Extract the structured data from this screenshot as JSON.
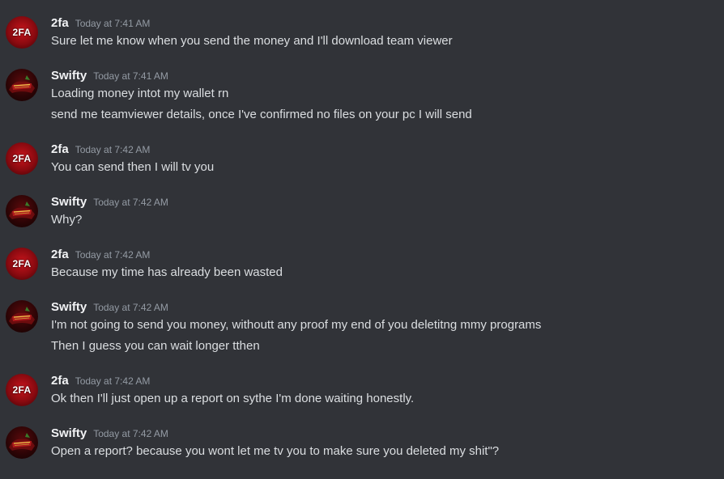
{
  "messages": [
    {
      "author": "2fa",
      "avatar_text": "2FA",
      "timestamp": "Today at 7:41 AM",
      "lines": [
        "Sure let me know when you send the money and I'll download team viewer"
      ]
    },
    {
      "author": "Swifty",
      "avatar_text": "",
      "timestamp": "Today at 7:41 AM",
      "lines": [
        "Loading money intot my wallet rn",
        "send me teamviewer details, once I've confirmed no files on your pc I will send"
      ]
    },
    {
      "author": "2fa",
      "avatar_text": "2FA",
      "timestamp": "Today at 7:42 AM",
      "lines": [
        "You can send then I will tv you"
      ]
    },
    {
      "author": "Swifty",
      "avatar_text": "",
      "timestamp": "Today at 7:42 AM",
      "lines": [
        "Why?"
      ]
    },
    {
      "author": "2fa",
      "avatar_text": "2FA",
      "timestamp": "Today at 7:42 AM",
      "lines": [
        "Because my time has already been wasted"
      ]
    },
    {
      "author": "Swifty",
      "avatar_text": "",
      "timestamp": "Today at 7:42 AM",
      "lines": [
        "I'm not going to send you money, withoutt any proof my end of you deletitng mmy programs",
        "Then I guess you can wait longer tthen"
      ]
    },
    {
      "author": "2fa",
      "avatar_text": "2FA",
      "timestamp": "Today at 7:42 AM",
      "lines": [
        "Ok then I'll just open up a report on sythe I'm done waiting honestly."
      ]
    },
    {
      "author": "Swifty",
      "avatar_text": "",
      "timestamp": "Today at 7:42 AM",
      "lines": [
        "Open a report? because you wont let me tv you to make sure you deleted my shit\"?"
      ]
    }
  ],
  "colors": {
    "background": "#313338",
    "username": "#f2f3f5",
    "timestamp": "#949ba4",
    "message_text": "#dbdee1",
    "avatar_2fa_red": "#c8141c"
  },
  "icons": {
    "avatar_2fa": "2fa-logo-avatar",
    "avatar_swifty": "swifty-logo-avatar"
  }
}
